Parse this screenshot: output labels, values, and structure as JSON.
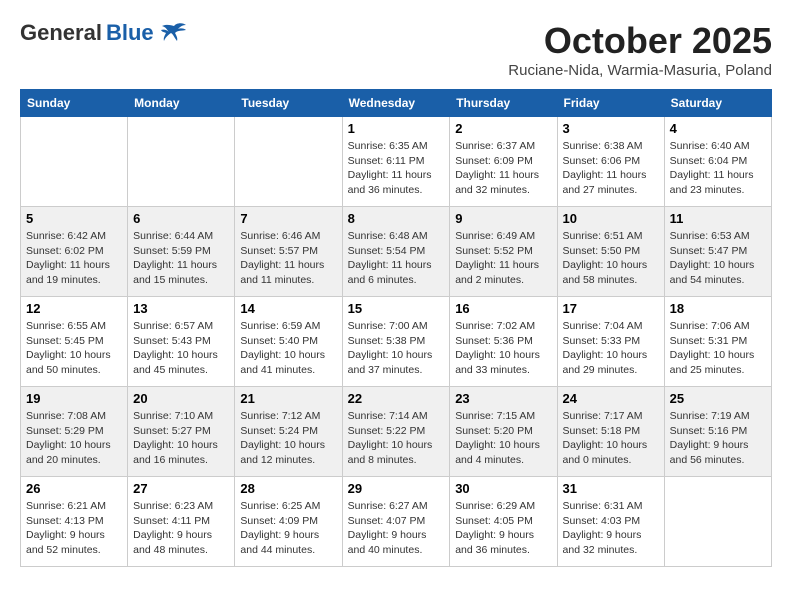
{
  "header": {
    "logo_general": "General",
    "logo_blue": "Blue",
    "month_title": "October 2025",
    "subtitle": "Ruciane-Nida, Warmia-Masuria, Poland"
  },
  "weekdays": [
    "Sunday",
    "Monday",
    "Tuesday",
    "Wednesday",
    "Thursday",
    "Friday",
    "Saturday"
  ],
  "weeks": [
    [
      {
        "day": "",
        "info": ""
      },
      {
        "day": "",
        "info": ""
      },
      {
        "day": "",
        "info": ""
      },
      {
        "day": "1",
        "info": "Sunrise: 6:35 AM\nSunset: 6:11 PM\nDaylight: 11 hours\nand 36 minutes."
      },
      {
        "day": "2",
        "info": "Sunrise: 6:37 AM\nSunset: 6:09 PM\nDaylight: 11 hours\nand 32 minutes."
      },
      {
        "day": "3",
        "info": "Sunrise: 6:38 AM\nSunset: 6:06 PM\nDaylight: 11 hours\nand 27 minutes."
      },
      {
        "day": "4",
        "info": "Sunrise: 6:40 AM\nSunset: 6:04 PM\nDaylight: 11 hours\nand 23 minutes."
      }
    ],
    [
      {
        "day": "5",
        "info": "Sunrise: 6:42 AM\nSunset: 6:02 PM\nDaylight: 11 hours\nand 19 minutes."
      },
      {
        "day": "6",
        "info": "Sunrise: 6:44 AM\nSunset: 5:59 PM\nDaylight: 11 hours\nand 15 minutes."
      },
      {
        "day": "7",
        "info": "Sunrise: 6:46 AM\nSunset: 5:57 PM\nDaylight: 11 hours\nand 11 minutes."
      },
      {
        "day": "8",
        "info": "Sunrise: 6:48 AM\nSunset: 5:54 PM\nDaylight: 11 hours\nand 6 minutes."
      },
      {
        "day": "9",
        "info": "Sunrise: 6:49 AM\nSunset: 5:52 PM\nDaylight: 11 hours\nand 2 minutes."
      },
      {
        "day": "10",
        "info": "Sunrise: 6:51 AM\nSunset: 5:50 PM\nDaylight: 10 hours\nand 58 minutes."
      },
      {
        "day": "11",
        "info": "Sunrise: 6:53 AM\nSunset: 5:47 PM\nDaylight: 10 hours\nand 54 minutes."
      }
    ],
    [
      {
        "day": "12",
        "info": "Sunrise: 6:55 AM\nSunset: 5:45 PM\nDaylight: 10 hours\nand 50 minutes."
      },
      {
        "day": "13",
        "info": "Sunrise: 6:57 AM\nSunset: 5:43 PM\nDaylight: 10 hours\nand 45 minutes."
      },
      {
        "day": "14",
        "info": "Sunrise: 6:59 AM\nSunset: 5:40 PM\nDaylight: 10 hours\nand 41 minutes."
      },
      {
        "day": "15",
        "info": "Sunrise: 7:00 AM\nSunset: 5:38 PM\nDaylight: 10 hours\nand 37 minutes."
      },
      {
        "day": "16",
        "info": "Sunrise: 7:02 AM\nSunset: 5:36 PM\nDaylight: 10 hours\nand 33 minutes."
      },
      {
        "day": "17",
        "info": "Sunrise: 7:04 AM\nSunset: 5:33 PM\nDaylight: 10 hours\nand 29 minutes."
      },
      {
        "day": "18",
        "info": "Sunrise: 7:06 AM\nSunset: 5:31 PM\nDaylight: 10 hours\nand 25 minutes."
      }
    ],
    [
      {
        "day": "19",
        "info": "Sunrise: 7:08 AM\nSunset: 5:29 PM\nDaylight: 10 hours\nand 20 minutes."
      },
      {
        "day": "20",
        "info": "Sunrise: 7:10 AM\nSunset: 5:27 PM\nDaylight: 10 hours\nand 16 minutes."
      },
      {
        "day": "21",
        "info": "Sunrise: 7:12 AM\nSunset: 5:24 PM\nDaylight: 10 hours\nand 12 minutes."
      },
      {
        "day": "22",
        "info": "Sunrise: 7:14 AM\nSunset: 5:22 PM\nDaylight: 10 hours\nand 8 minutes."
      },
      {
        "day": "23",
        "info": "Sunrise: 7:15 AM\nSunset: 5:20 PM\nDaylight: 10 hours\nand 4 minutes."
      },
      {
        "day": "24",
        "info": "Sunrise: 7:17 AM\nSunset: 5:18 PM\nDaylight: 10 hours\nand 0 minutes."
      },
      {
        "day": "25",
        "info": "Sunrise: 7:19 AM\nSunset: 5:16 PM\nDaylight: 9 hours\nand 56 minutes."
      }
    ],
    [
      {
        "day": "26",
        "info": "Sunrise: 6:21 AM\nSunset: 4:13 PM\nDaylight: 9 hours\nand 52 minutes."
      },
      {
        "day": "27",
        "info": "Sunrise: 6:23 AM\nSunset: 4:11 PM\nDaylight: 9 hours\nand 48 minutes."
      },
      {
        "day": "28",
        "info": "Sunrise: 6:25 AM\nSunset: 4:09 PM\nDaylight: 9 hours\nand 44 minutes."
      },
      {
        "day": "29",
        "info": "Sunrise: 6:27 AM\nSunset: 4:07 PM\nDaylight: 9 hours\nand 40 minutes."
      },
      {
        "day": "30",
        "info": "Sunrise: 6:29 AM\nSunset: 4:05 PM\nDaylight: 9 hours\nand 36 minutes."
      },
      {
        "day": "31",
        "info": "Sunrise: 6:31 AM\nSunset: 4:03 PM\nDaylight: 9 hours\nand 32 minutes."
      },
      {
        "day": "",
        "info": ""
      }
    ]
  ]
}
